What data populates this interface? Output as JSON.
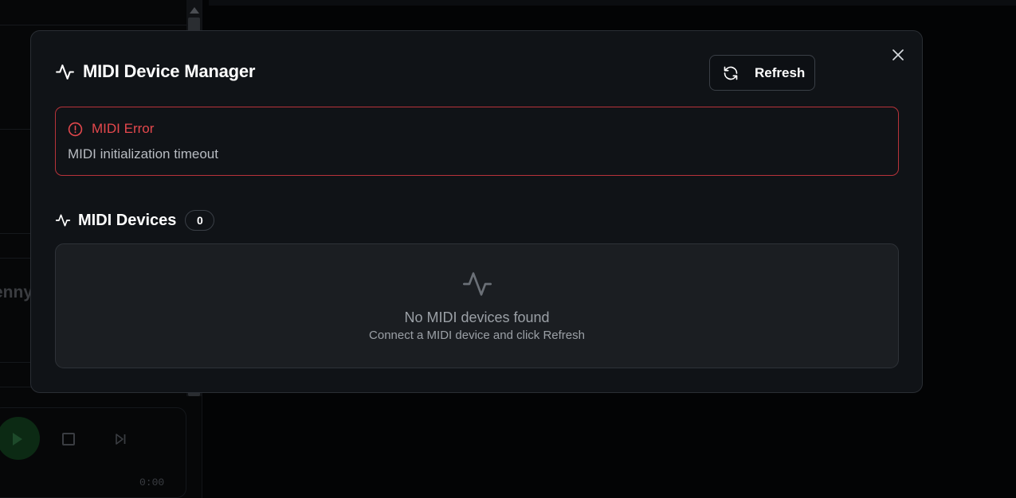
{
  "modal": {
    "title": "MIDI Device Manager",
    "refresh_label": "Refresh",
    "close_icon": "close-icon",
    "title_icon": "activity-icon"
  },
  "error": {
    "title": "MIDI Error",
    "message": "MIDI initialization timeout",
    "icon": "alert-circle-icon",
    "color": "#e5484d"
  },
  "devices": {
    "title": "MIDI Devices",
    "count": "0",
    "empty_title": "No MIDI devices found",
    "empty_subtitle": "Connect a MIDI device and click Refresh"
  },
  "background": {
    "partial_name": "enny",
    "time": "0:00"
  }
}
